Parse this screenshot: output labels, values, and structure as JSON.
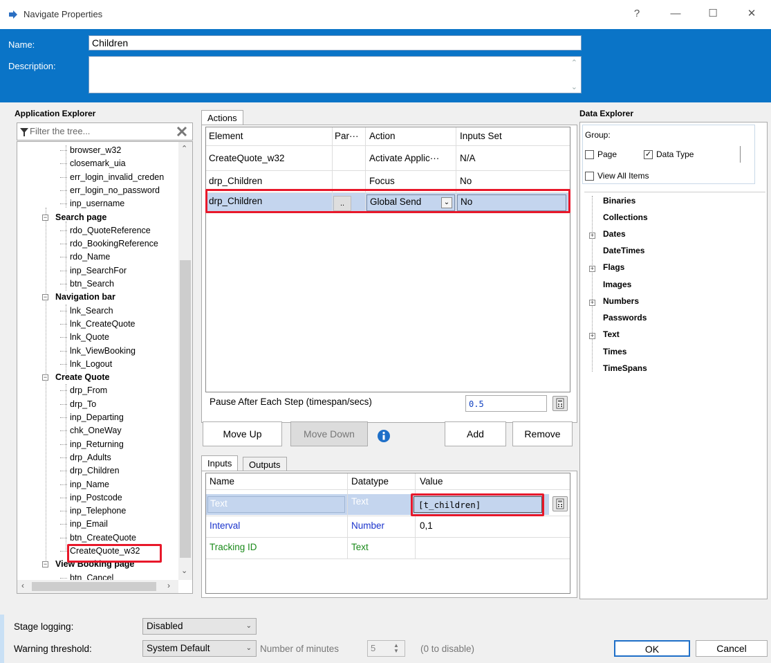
{
  "window": {
    "title": "Navigate Properties",
    "help": "?",
    "minimize": "—",
    "maximize": "☐",
    "close": "✕"
  },
  "header": {
    "name_label": "Name:",
    "name_value": "Children",
    "description_label": "Description:",
    "description_value": ""
  },
  "app_explorer": {
    "title": "Application Explorer",
    "filter_placeholder": "Filter the tree...",
    "items": [
      {
        "label": "browser_w32",
        "kind": "leaf"
      },
      {
        "label": "closemark_uia",
        "kind": "leaf"
      },
      {
        "label": "err_login_invalid_creden",
        "kind": "leaf"
      },
      {
        "label": "err_login_no_password",
        "kind": "leaf"
      },
      {
        "label": "inp_username",
        "kind": "leaf"
      },
      {
        "label": "Search page",
        "kind": "group"
      },
      {
        "label": "rdo_QuoteReference",
        "kind": "leaf"
      },
      {
        "label": "rdo_BookingReference",
        "kind": "leaf"
      },
      {
        "label": "rdo_Name",
        "kind": "leaf"
      },
      {
        "label": "inp_SearchFor",
        "kind": "leaf"
      },
      {
        "label": "btn_Search",
        "kind": "leaf"
      },
      {
        "label": "Navigation bar",
        "kind": "group"
      },
      {
        "label": "lnk_Search",
        "kind": "leaf"
      },
      {
        "label": "lnk_CreateQuote",
        "kind": "leaf"
      },
      {
        "label": "lnk_Quote",
        "kind": "leaf"
      },
      {
        "label": "lnk_ViewBooking",
        "kind": "leaf"
      },
      {
        "label": "lnk_Logout",
        "kind": "leaf"
      },
      {
        "label": "Create Quote",
        "kind": "group"
      },
      {
        "label": "drp_From",
        "kind": "leaf"
      },
      {
        "label": "drp_To",
        "kind": "leaf"
      },
      {
        "label": "inp_Departing",
        "kind": "leaf"
      },
      {
        "label": "chk_OneWay",
        "kind": "leaf"
      },
      {
        "label": "inp_Returning",
        "kind": "leaf"
      },
      {
        "label": "drp_Adults",
        "kind": "leaf"
      },
      {
        "label": "drp_Children",
        "kind": "leaf"
      },
      {
        "label": "inp_Name",
        "kind": "leaf"
      },
      {
        "label": "inp_Postcode",
        "kind": "leaf"
      },
      {
        "label": "inp_Telephone",
        "kind": "leaf"
      },
      {
        "label": "inp_Email",
        "kind": "leaf"
      },
      {
        "label": "btn_CreateQuote",
        "kind": "leaf"
      },
      {
        "label": "CreateQuote_w32",
        "kind": "leaf"
      },
      {
        "label": "View Booking page",
        "kind": "group"
      },
      {
        "label": "btn_Cancel",
        "kind": "leaf"
      }
    ]
  },
  "actions": {
    "tab": "Actions",
    "columns": [
      "Element",
      "Par···",
      "Action",
      "Inputs Set"
    ],
    "rows": [
      {
        "element": "CreateQuote_w32",
        "params": "",
        "action": "Activate  Applic···",
        "inputs_set": "N/A"
      },
      {
        "element": "drp_Children",
        "params": "",
        "action": "Focus",
        "inputs_set": "No"
      },
      {
        "element": "drp_Children",
        "params": "..",
        "action": "Global Send",
        "inputs_set": "No"
      }
    ],
    "pause_label": "Pause After Each Step (timespan/secs)",
    "pause_value": "0.5",
    "move_up": "Move Up",
    "move_down": "Move Down",
    "add": "Add",
    "remove": "Remove"
  },
  "inputs": {
    "tab_inputs": "Inputs",
    "tab_outputs": "Outputs",
    "columns": [
      "Name",
      "Datatype",
      "Value"
    ],
    "rows": [
      {
        "name": "Text",
        "datatype": "Text",
        "value": "[t_children]"
      },
      {
        "name": "Interval",
        "datatype": "Number",
        "value": "0,1"
      },
      {
        "name": "Tracking ID",
        "datatype": "Text",
        "value": ""
      }
    ]
  },
  "data_explorer": {
    "title": "Data Explorer",
    "group_label": "Group:",
    "page_label": "Page",
    "page_checked": false,
    "data_type_label": "Data Type",
    "data_type_checked": true,
    "view_all_label": "View All Items",
    "view_all_checked": false,
    "items": [
      "Binaries",
      "Collections",
      "Dates",
      "DateTimes",
      "Flags",
      "Images",
      "Numbers",
      "Passwords",
      "Text",
      "Times",
      "TimeSpans"
    ]
  },
  "bottom": {
    "stage_logging_label": "Stage logging:",
    "stage_logging_value": "Disabled",
    "warning_label": "Warning threshold:",
    "warning_value": "System Default",
    "minutes_label": "Number of minutes",
    "minutes_value": "5",
    "disable_hint": "(0 to disable)",
    "ok": "OK",
    "cancel": "Cancel"
  },
  "colors": {
    "header_blue": "#0a74c7",
    "highlight_red": "#e8182a",
    "selection": "#c4d5ee",
    "param_blue": "#1a33cc",
    "param_green": "#1a8a1a"
  }
}
